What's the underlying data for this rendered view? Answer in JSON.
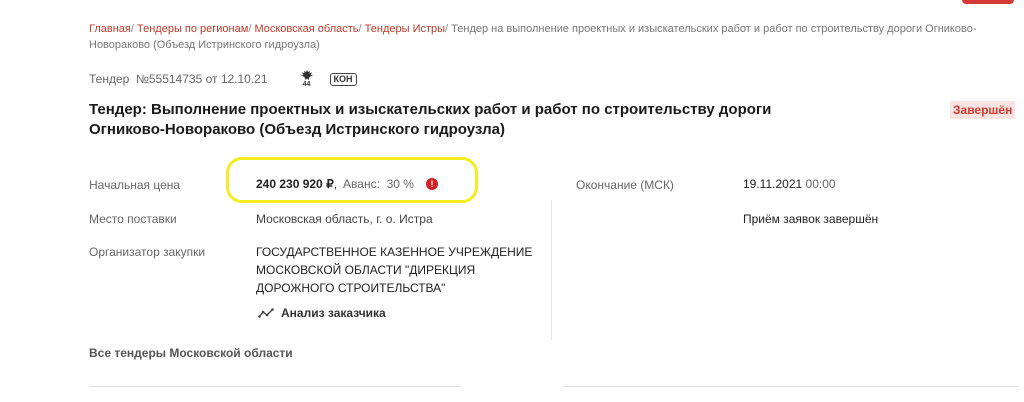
{
  "breadcrumb": {
    "items": [
      "Главная",
      "Тендеры по регионам",
      "Московская область",
      "Тендеры Истры"
    ],
    "separator": "/",
    "current": "Тендер на выполнение проектных и изыскательских работ и работ по строительству дороги Огниково-Новораково (Объезд Истринского гидроузла)"
  },
  "meta": {
    "tender_label": "Тендер  №55514735 от 12.10.21",
    "law_number": "44",
    "badge": "КОН"
  },
  "title": "Тендер: Выполнение проектных и изыскательских работ и работ по строительству дороги Огниково-Новораково (Объезд Истринского гидроузла)",
  "status": "Завершён",
  "details": {
    "price_label": "Начальная цена",
    "price_value": "240 230 920 ₽",
    "advance": "Аванс:  30 %",
    "delivery_label": "Место поставки",
    "delivery_value": "Московская область, г. о. Истра",
    "organizer_label": "Организатор закупки",
    "organizer_value": "ГОСУДАРСТВЕННОЕ КАЗЕННОЕ УЧРЕЖДЕНИЕ МОСКОВСКОЙ ОБЛАСТИ \"ДИРЕКЦИЯ ДОРОЖНОГО СТРОИТЕЛЬСТВА\"",
    "analysis_link": "Анализ заказчика",
    "end_label": "Окончание (МСК)",
    "end_date": "19.11.2021",
    "end_time": "00:00",
    "applications_status": "Приём заявок завершён"
  },
  "all_tenders_link": "Все тендеры Московской области",
  "colors": {
    "accent_red": "#d63a36",
    "link_red": "#c0392b",
    "status_bg": "#fbe3e2",
    "highlight_yellow": "#f6ec20"
  }
}
